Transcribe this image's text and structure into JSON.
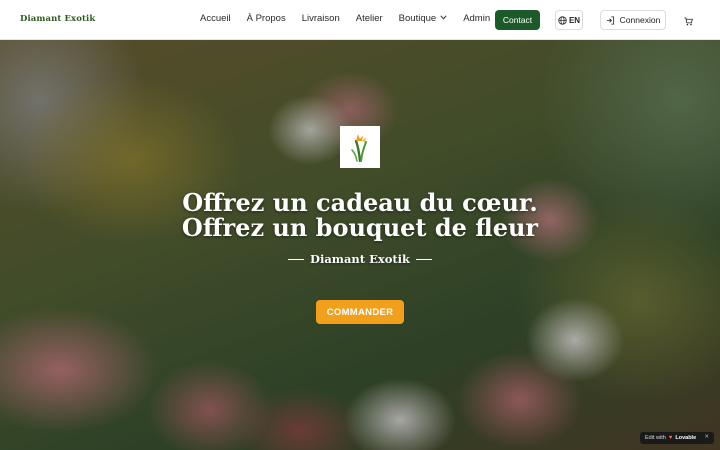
{
  "brand": {
    "name": "Diamant Exotik"
  },
  "nav": {
    "items": [
      {
        "label": "Accueil"
      },
      {
        "label": "À Propos"
      },
      {
        "label": "Livraison"
      },
      {
        "label": "Atelier"
      },
      {
        "label": "Boutique",
        "has_dropdown": true
      },
      {
        "label": "Admin"
      }
    ],
    "contact_label": "Contact",
    "language": "EN",
    "login_label": "Connexion",
    "icons": {
      "language": "globe-icon",
      "login": "login-icon",
      "cart": "cart-icon",
      "dropdown": "chevron-down-icon"
    }
  },
  "hero": {
    "title_line1": "Offrez un cadeau du cœur.",
    "title_line2": "Offrez un bouquet de fleur",
    "subtitle": "Diamant Exotik",
    "cta_label": "COMMANDER",
    "emblem_icon": "flower-logo-icon"
  },
  "badge": {
    "prefix": "Edit with",
    "brand": "Lovable"
  },
  "colors": {
    "brand_green": "#1d5a2a",
    "logo_green": "#2f5a1f",
    "cta_orange": "#f2a01c"
  }
}
